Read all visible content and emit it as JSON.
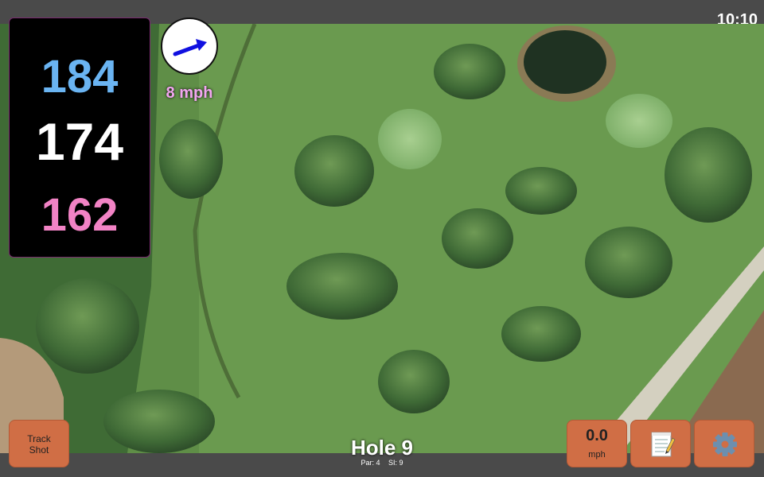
{
  "status": {
    "time": "10:10"
  },
  "distances": {
    "back": "184",
    "middle": "174",
    "front": "162"
  },
  "wind": {
    "label": "8 mph",
    "icon": "wind-direction-arrow-icon",
    "arrow_color": "#1010e0"
  },
  "buttons": {
    "track_shot_line1": "Track",
    "track_shot_line2": "Shot",
    "wind_speed": "0.0",
    "wind_unit": "mph",
    "notes_icon": "scorecard-notepad-icon",
    "settings_icon": "gear-icon"
  },
  "hole": {
    "title": "Hole 9",
    "par": "Par: 4",
    "si": "SI: 9"
  },
  "colors": {
    "back": "#6ab4f2",
    "middle": "#ffffff",
    "front": "#f283c5",
    "button": "#d06e45",
    "wind_label": "#f2a6f0"
  }
}
